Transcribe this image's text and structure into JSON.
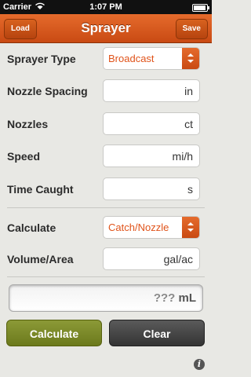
{
  "status_bar": {
    "carrier": "Carrier",
    "time": "1:07 PM"
  },
  "nav": {
    "load": "Load",
    "title": "Sprayer",
    "save": "Save"
  },
  "form": {
    "sprayer_type": {
      "label": "Sprayer Type",
      "value": "Broadcast"
    },
    "nozzle_spacing": {
      "label": "Nozzle Spacing",
      "unit": "in"
    },
    "nozzles": {
      "label": "Nozzles",
      "unit": "ct"
    },
    "speed": {
      "label": "Speed",
      "unit": "mi/h"
    },
    "time_caught": {
      "label": "Time Caught",
      "unit": "s"
    },
    "calculate": {
      "label": "Calculate",
      "value": "Catch/Nozzle"
    },
    "volume_area": {
      "label": "Volume/Area",
      "unit": "gal/ac"
    }
  },
  "result": {
    "value": "???",
    "unit": "mL"
  },
  "actions": {
    "calculate": "Calculate",
    "clear": "Clear"
  },
  "info_glyph": "i",
  "colors": {
    "accent": "#e0531a",
    "calculate_button": "#7c8a28",
    "clear_button": "#444444"
  }
}
